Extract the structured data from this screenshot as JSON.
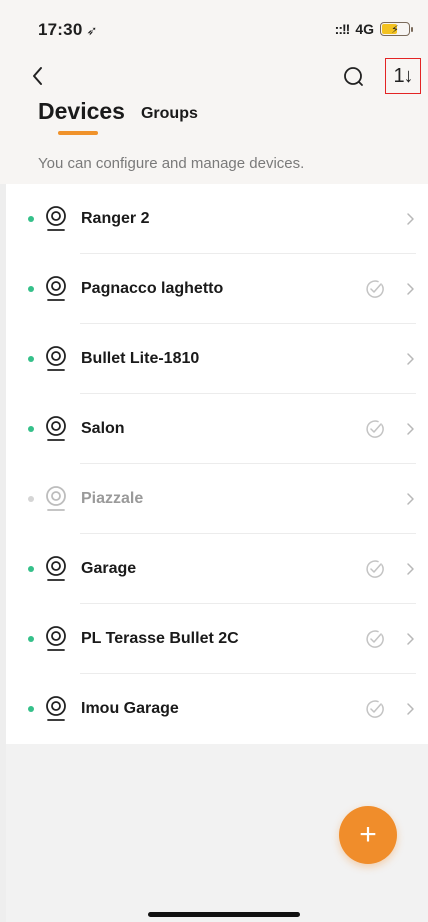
{
  "status_bar": {
    "time": "17:30",
    "location_glyph": "➶",
    "signal": "::!!",
    "network": "4G",
    "battery_bolt": "⚡"
  },
  "header": {
    "tabs": [
      {
        "label": "Devices",
        "active": true
      },
      {
        "label": "Groups",
        "active": false
      }
    ],
    "subtitle": "You can configure and manage devices.",
    "sort_glyph": "1↓"
  },
  "devices": [
    {
      "name": "Ranger 2",
      "online": true,
      "shared": false
    },
    {
      "name": "Pagnacco laghetto",
      "online": true,
      "shared": true
    },
    {
      "name": "Bullet Lite-1810",
      "online": true,
      "shared": false
    },
    {
      "name": "Salon",
      "online": true,
      "shared": true
    },
    {
      "name": "Piazzale",
      "online": false,
      "shared": false
    },
    {
      "name": "Garage",
      "online": true,
      "shared": true
    },
    {
      "name": "PL Terasse Bullet 2C",
      "online": true,
      "shared": true
    },
    {
      "name": "Imou Garage",
      "online": true,
      "shared": true
    }
  ],
  "fab_label": "+",
  "colors": {
    "accent": "#f08d2b",
    "online": "#35c08a",
    "offline": "#d5d5d5",
    "highlight_border": "#e32424"
  }
}
